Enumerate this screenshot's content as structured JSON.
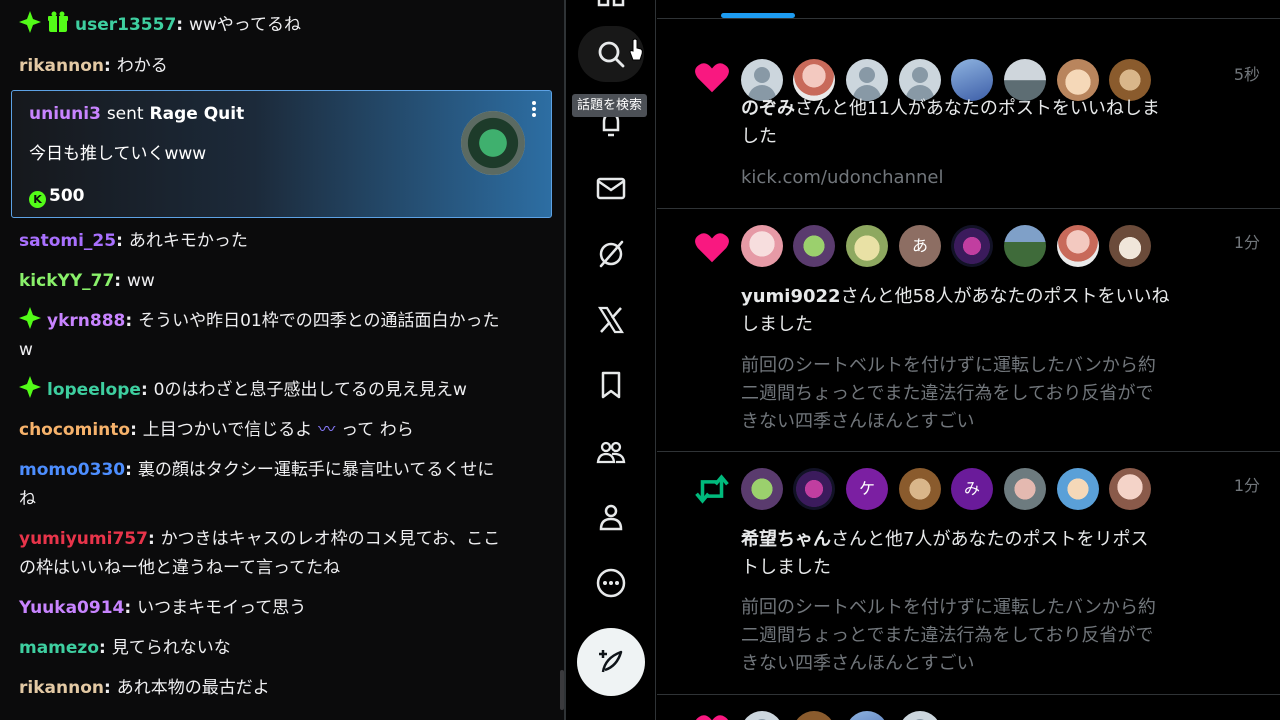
{
  "colors": {
    "chat_bg": "#0b0b0c",
    "gift_border": "#5da2e5",
    "kick_green": "#53fc18",
    "like_pink": "#f91880",
    "repost_green": "#00ba7c",
    "x_blue": "#1d9bf0",
    "muted_text": "#71767b"
  },
  "chat": {
    "messages": [
      {
        "user": "user13557",
        "color": "#3ecfa0",
        "text": "wwやってるね",
        "badges": [
          "vip-diamond-icon",
          "gift-box-icon"
        ]
      },
      {
        "user": "rikannon",
        "color": "#e3c9a4",
        "text": "わかる",
        "badges": []
      },
      {
        "user": "satomi_25",
        "color": "#a970ff",
        "text": "あれキモかった",
        "badges": []
      },
      {
        "user": "kickYY_77",
        "color": "#89f06a",
        "text": "ww",
        "badges": []
      },
      {
        "user": "ykrn888",
        "color": "#c884ff",
        "text": "そういや昨日01枠での四季との通話面白かった",
        "text2": "w",
        "badges": [
          "vip-diamond-icon"
        ]
      },
      {
        "user": "lopeelope",
        "color": "#3ecfa0",
        "text": "0のはわざと息子感出してるの見え見えw",
        "badges": [
          "vip-diamond-icon"
        ]
      },
      {
        "user": "chocominto",
        "color": "#f6b26b",
        "text": "上目つかいで信じるよ",
        "emote": "〰",
        "text_after": "って わら",
        "badges": []
      },
      {
        "user": "momo0330",
        "color": "#4d8eff",
        "text": "裏の顔はタクシー運転手に暴言吐いてるくせに",
        "text2": "ね",
        "badges": []
      },
      {
        "user": "yumiyumi757",
        "color": "#e8344a",
        "text": "かつきはキャスのレオ枠のコメ見てお、ここ",
        "text2": "の枠はいいねー他と違うねーて言ってたね",
        "badges": []
      },
      {
        "user": "Yuuka0914",
        "color": "#c884ff",
        "text": "いつまキモイって思う",
        "badges": []
      },
      {
        "user": "mamezo",
        "color": "#3ecfa0",
        "text": "見てられないな",
        "badges": []
      },
      {
        "user": "rikannon",
        "color": "#e3c9a4",
        "text": "あれ本物の最古だよ",
        "badges": []
      }
    ],
    "gift": {
      "user": "uniuni3",
      "user_color": "#c884ff",
      "sent_label": "sent",
      "gift_name": "Rage Quit",
      "message": "今日も推していくwww",
      "coin_glyph": "K",
      "amount": "500"
    }
  },
  "nav": {
    "tooltip": "話題を検索",
    "items": [
      "home-icon",
      "search-icon",
      "notifications-icon",
      "messages-icon",
      "grok-icon",
      "x-logo-icon",
      "bookmarks-icon",
      "communities-icon",
      "profile-icon",
      "more-icon",
      "post-icon"
    ]
  },
  "notifications": [
    {
      "type": "like",
      "time": "5秒",
      "name": "のぞみ",
      "text": "さんと他11人があなたのポストをいいねしま",
      "text2": "した",
      "sub": [
        "kick.com/udonchannel"
      ]
    },
    {
      "type": "like",
      "time": "1分",
      "name": "yumi9022",
      "text": "さんと他58人があなたのポストをいいね",
      "text2": "しました",
      "sub": [
        "前回のシートベルトを付けずに運転したバンから約",
        "二週間ちょっとでまた違法行為をしており反省がで",
        "きない四季さんほんとすごい"
      ]
    },
    {
      "type": "repost",
      "time": "1分",
      "name": "希望ちゃん",
      "text": "さんと他7人があなたのポストをリポス",
      "text2": "トしました",
      "sub": [
        "前回のシートベルトを付けずに運転したバンから約",
        "二週間ちょっとでまた違法行為をしており反省がで",
        "きない四季さんほんとすごい"
      ]
    }
  ],
  "avatar_letters": {
    "a": "あ",
    "ke": "ケ",
    "mi": "み"
  }
}
